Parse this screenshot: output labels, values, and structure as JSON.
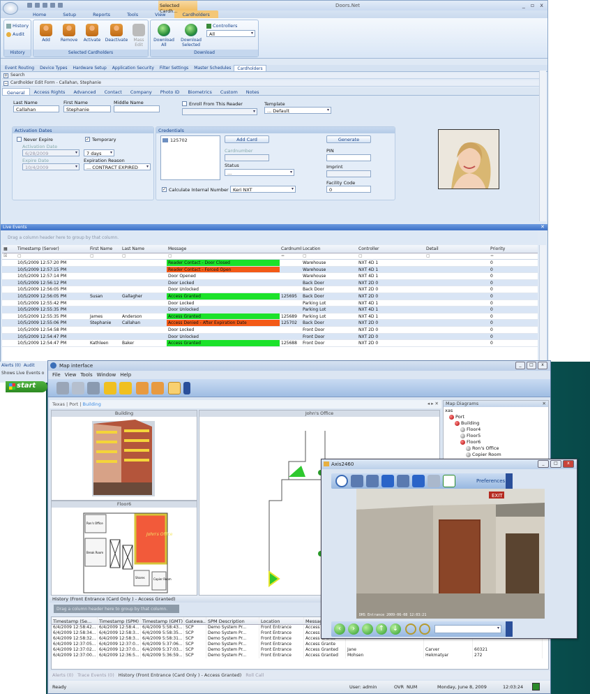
{
  "app": {
    "title": "Doors.Net",
    "context_tab": "Selected Cardh...",
    "ribbon_tabs": [
      "Home",
      "Setup",
      "Reports",
      "Tools",
      "View",
      "Cardholders"
    ],
    "history_group": {
      "label": "History",
      "items": [
        "History",
        "Audit"
      ]
    },
    "selected_group": {
      "label": "Selected Cardholders",
      "buttons": [
        "Add",
        "Remove",
        "Activate",
        "Deactivate",
        "Mass Edit"
      ]
    },
    "download_group": {
      "label": "Download",
      "buttons": [
        "Download All",
        "Download Selected"
      ],
      "controllers_label": "Controllers",
      "controllers_value": "All"
    },
    "doc_tabs": [
      "Event Routing",
      "Device Types",
      "Hardware Setup",
      "Application Security",
      "Filter Settings",
      "Master Schedules",
      "Cardholders"
    ],
    "search_label": "Search",
    "edit_form_title": "Cardholder Edit Form - Callahan, Stephanie",
    "form_tabs": [
      "General",
      "Access Rights",
      "Advanced",
      "Contact",
      "Company",
      "Photo ID",
      "Biometrics",
      "Custom",
      "Notes"
    ],
    "form": {
      "last_name_label": "Last Name",
      "last_name": "Callahan",
      "first_name_label": "First Name",
      "first_name": "Stephanie",
      "middle_name_label": "Middle Name",
      "middle_name": "",
      "enroll_label": "Enroll From This Reader",
      "template_label": "Template",
      "template_value": "... Default",
      "activation_title": "Activation Dates",
      "never_expire": "Never Expire",
      "temporary": "Temporary",
      "activation_date_label": "Activation Date",
      "activation_date": "6/28/2009",
      "expire_date_label": "Expire Date",
      "expire_date": "10/4/2009",
      "days_value": "7 days",
      "expiration_reason_label": "Expiration Reason",
      "expiration_reason": "... CONTRACT EXPIRED",
      "credentials_title": "Credentials",
      "credential_item": "125702",
      "add_card": "Add Card",
      "generate": "Generate",
      "cardnumber_label": "Cardnumber",
      "pin_label": "PIN",
      "status_label": "Status",
      "status_value": "...",
      "imprint_label": "Imprint",
      "facility_code_label": "Facility Code",
      "facility_code": "0",
      "calc_label": "Calculate Internal Number",
      "card_format": "Keri NXT"
    },
    "live_events": {
      "title": "Live Events",
      "drag_hint": "Drag a column header here to group by that column.",
      "columns": [
        "Timestamp (Server)",
        "First Name",
        "Last Name",
        "Message",
        "Cardnumber",
        "Location",
        "Controller",
        "Detail",
        "Priority"
      ],
      "rows": [
        [
          "10/5/2009 12:57:20 PM",
          "",
          "",
          "Reader Contact - Door Closed",
          "",
          "Warehouse",
          "NXT 4D 1",
          "",
          "0",
          "green"
        ],
        [
          "10/5/2009 12:57:15 PM",
          "",
          "",
          "Reader Contact - Forced Open",
          "",
          "Warehouse",
          "NXT 4D 1",
          "",
          "0",
          "red"
        ],
        [
          "10/5/2009 12:57:14 PM",
          "",
          "",
          "Door Opened",
          "",
          "Warehouse",
          "NXT 4D 1",
          "",
          "0",
          ""
        ],
        [
          "10/5/2009 12:56:12 PM",
          "",
          "",
          "Door Locked",
          "",
          "Back Door",
          "NXT 2D 0",
          "",
          "0",
          ""
        ],
        [
          "10/5/2009 12:56:05 PM",
          "",
          "",
          "Door Unlocked",
          "",
          "Back Door",
          "NXT 2D 0",
          "",
          "0",
          ""
        ],
        [
          "10/5/2009 12:56:05 PM",
          "Susan",
          "Gallagher",
          "Access Granted",
          "125695",
          "Back Door",
          "NXT 2D 0",
          "",
          "0",
          "green"
        ],
        [
          "10/5/2009 12:55:42 PM",
          "",
          "",
          "Door Locked",
          "",
          "Parking Lot",
          "NXT 4D 1",
          "",
          "0",
          ""
        ],
        [
          "10/5/2009 12:55:35 PM",
          "",
          "",
          "Door Unlocked",
          "",
          "Parking Lot",
          "NXT 4D 1",
          "",
          "0",
          ""
        ],
        [
          "10/5/2009 12:55:35 PM",
          "James",
          "Anderson",
          "Access Granted",
          "125689",
          "Parking Lot",
          "NXT 4D 1",
          "",
          "0",
          "green"
        ],
        [
          "10/5/2009 12:55:06 PM",
          "Stephanie",
          "Callahan",
          "Access Denied - After Expiration Date",
          "125702",
          "Back Door",
          "NXT 2D 0",
          "",
          "0",
          "red"
        ],
        [
          "10/5/2009 12:54:58 PM",
          "",
          "",
          "Door Locked",
          "",
          "Front Door",
          "NXT 2D 0",
          "",
          "0",
          ""
        ],
        [
          "10/5/2009 12:54:47 PM",
          "",
          "",
          "Door Unlocked",
          "",
          "Front Door",
          "NXT 2D 0",
          "",
          "0",
          ""
        ],
        [
          "10/5/2009 12:54:47 PM",
          "Kathleen",
          "Baker",
          "Access Granted",
          "125688",
          "Front Door",
          "NXT 2D 0",
          "",
          "0",
          "green"
        ]
      ]
    },
    "bottom_left": {
      "alerts": "Alerts (0)",
      "audit": "Audit",
      "shows": "Shows Live Events o"
    }
  },
  "taskbar": {
    "start": "start"
  },
  "map_window": {
    "title": "Map interface",
    "menu": [
      "File",
      "View",
      "Tools",
      "Window",
      "Help"
    ],
    "tabs": [
      "Texas",
      "Port",
      "Building"
    ],
    "building_pane": "Building",
    "floor_pane": "Floor6",
    "office_pane": "John's Office",
    "floor_rooms": [
      "Ron's Office",
      "Break Room",
      "John's Office",
      "Shares",
      "Copier Room"
    ],
    "diagrams_title": "Map Diagrams",
    "tree": [
      "xas",
      "Port",
      "Building",
      "Floor4",
      "Floor5",
      "Floor6",
      "Ron's Office",
      "Copier Room"
    ],
    "history_title": "History (Front Entrance (Card Only ) - Access Granted)",
    "history_drag": "Drag a column header here to group by that column.",
    "history_columns": [
      "Timestamp (Se...",
      "Timestamp (SPM)",
      "Timestamp (GMT)",
      "Gatewa...",
      "SPM Description",
      "Location",
      "Message",
      "",
      "",
      ""
    ],
    "history_rows": [
      [
        "6/4/2009 12:58:42...",
        "6/4/2009 12:58:4...",
        "6/4/2009 5:58:43...",
        "SCP",
        "Demo System Pr...",
        "Front Entrance",
        "Access Grante",
        "",
        "",
        ""
      ],
      [
        "6/4/2009 12:58:34...",
        "6/4/2009 12:58:3...",
        "6/4/2009 5:58:35...",
        "SCP",
        "Demo System Pr...",
        "Front Entrance",
        "Access Grante",
        "",
        "",
        ""
      ],
      [
        "6/4/2009 12:58:32...",
        "6/4/2009 12:58:3...",
        "6/4/2009 5:58:31...",
        "SCP",
        "Demo System Pr...",
        "Front Entrance",
        "Access Grante",
        "",
        "",
        ""
      ],
      [
        "6/4/2009 12:37:05...",
        "6/4/2009 12:37:0...",
        "6/4/2009 5:37:06...",
        "SCP",
        "Demo System Pr...",
        "Front Entrance",
        "Access Grante",
        "",
        "",
        ""
      ],
      [
        "6/4/2009 12:37:02...",
        "6/4/2009 12:37:0...",
        "6/4/2009 5:37:03...",
        "SCP",
        "Demo System Pr...",
        "Front Entrance",
        "Access Granted",
        "Jane",
        "Carver",
        "60321"
      ],
      [
        "6/4/2009 12:37:00...",
        "6/4/2009 12:36:5...",
        "6/4/2009 5:36:59...",
        "SCP",
        "Demo System Pr...",
        "Front Entrance",
        "Access Granted",
        "Mohsen",
        "Hekmatyar",
        "272"
      ]
    ],
    "bottom_tabs": [
      "Alerts (0)",
      "Trace Events (0)",
      "History (Front Entrance (Card Only ) - Access Granted)",
      "Roll Call"
    ],
    "status": {
      "ready": "Ready",
      "user": "User: admin",
      "ovr": "OVR",
      "num": "NUM",
      "date": "Monday, June 8, 2009",
      "time": "12:03:24"
    }
  },
  "axis_window": {
    "title": "Axis2460",
    "preferences": "Preferences",
    "exit_sign": "EXIT",
    "cam_caption": "DHS Entrance 2009-06-08 12:03:21"
  }
}
